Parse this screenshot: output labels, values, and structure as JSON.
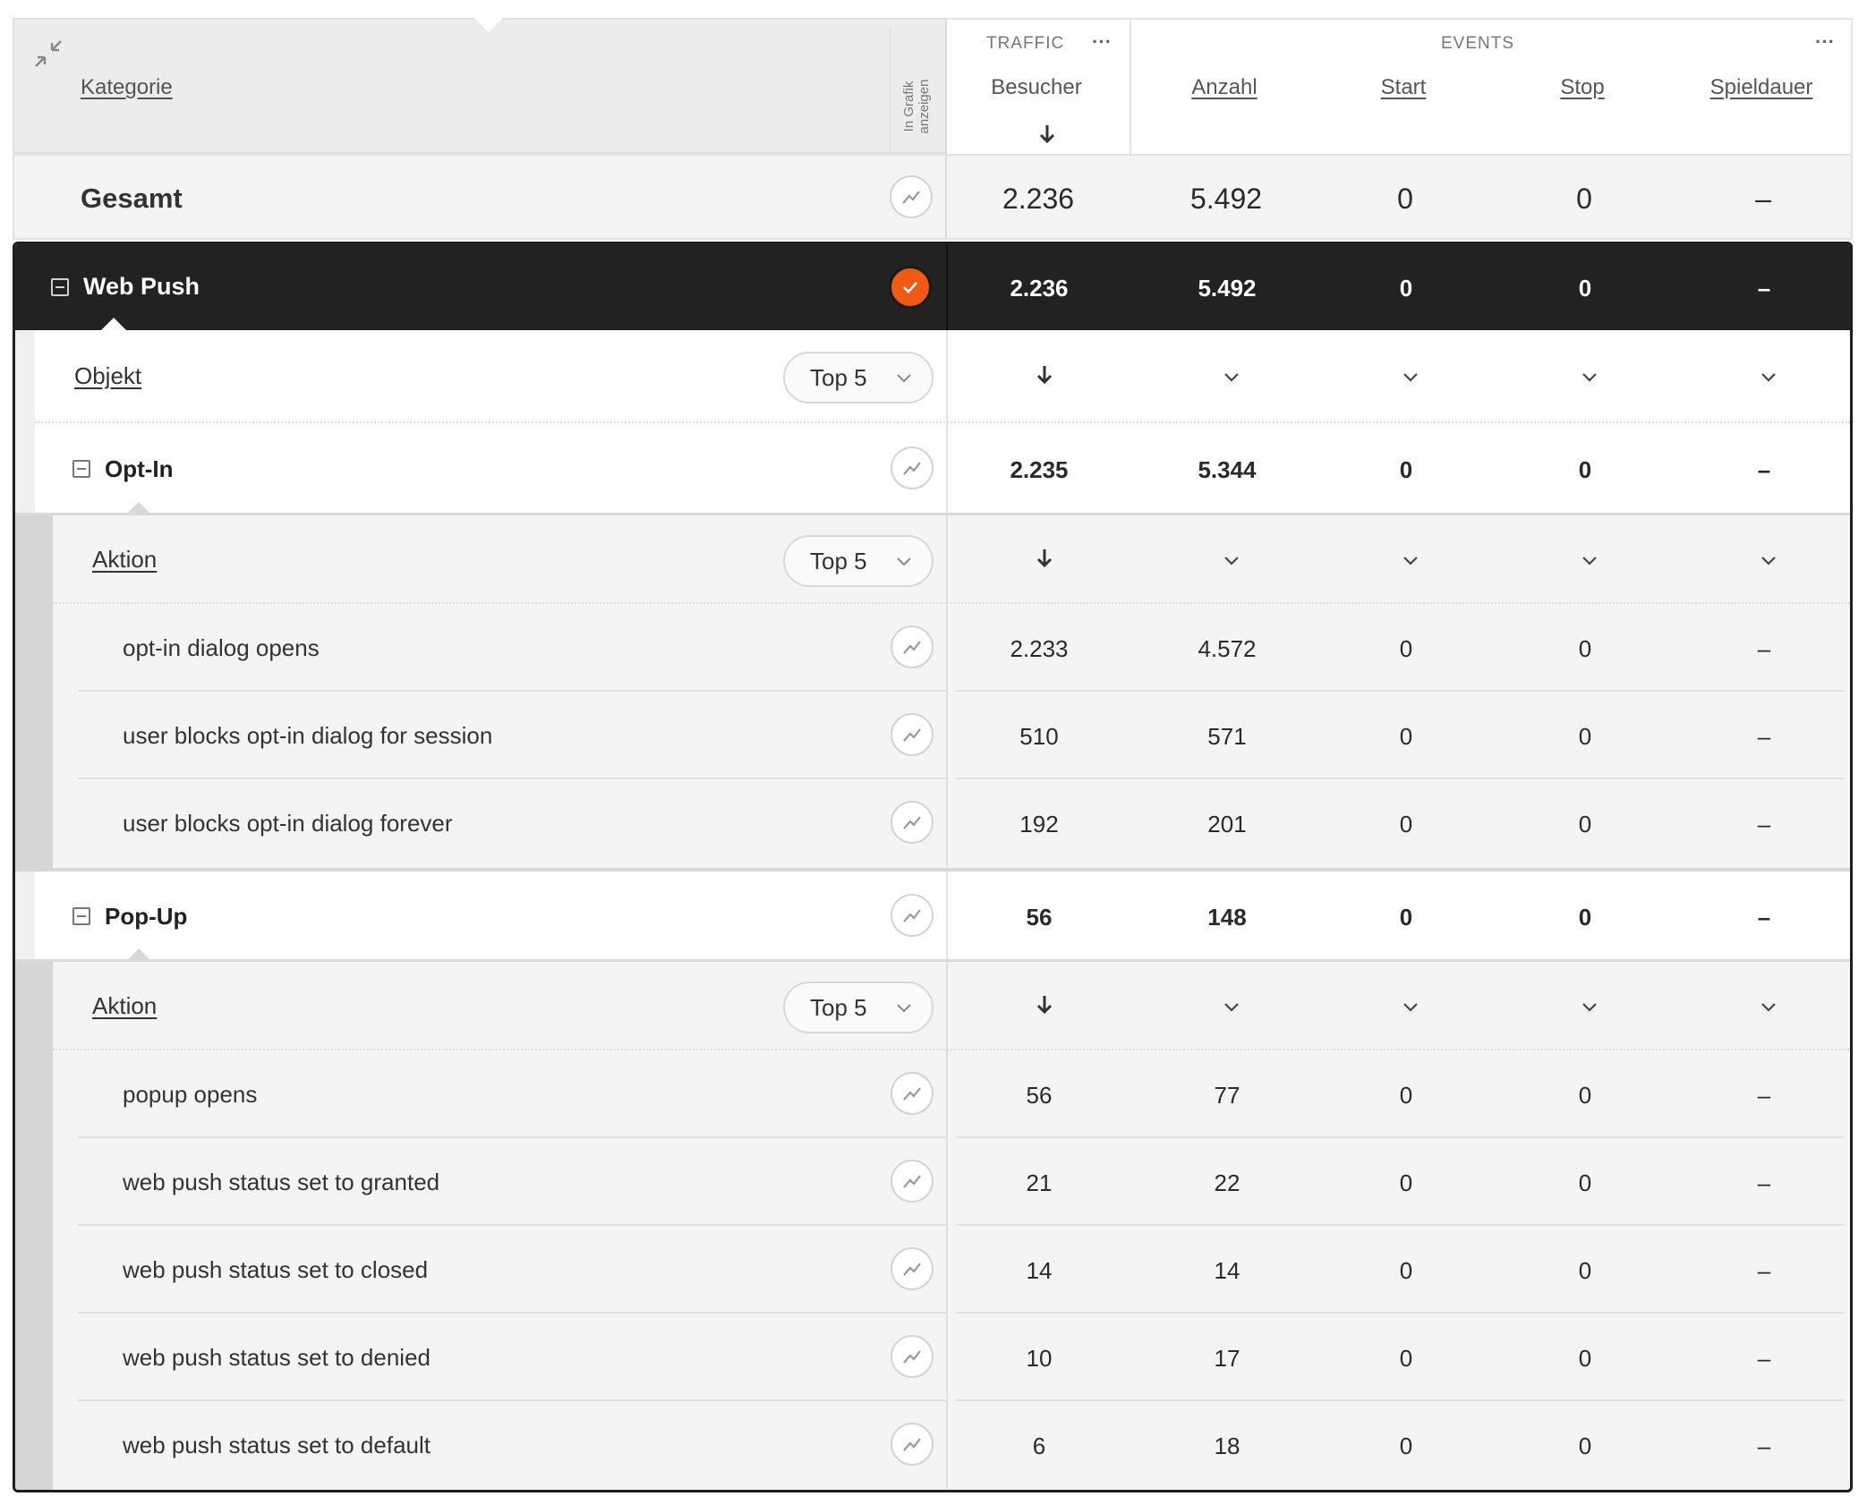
{
  "header": {
    "kategorie": "Kategorie",
    "chart_toggle_label": "In Grafik anzeigen",
    "groups": {
      "traffic": "TRAFFIC",
      "events": "EVENTS"
    },
    "columns": [
      "Besucher",
      "Anzahl",
      "Start",
      "Stop",
      "Spieldauer"
    ]
  },
  "total": {
    "label": "Gesamt",
    "values": [
      "2.236",
      "5.492",
      "0",
      "0",
      "–"
    ]
  },
  "web_push": {
    "label": "Web Push",
    "values": [
      "2.236",
      "5.492",
      "0",
      "0",
      "–"
    ]
  },
  "objekt": {
    "label": "Objekt",
    "top": "Top 5"
  },
  "opt_in": {
    "label": "Opt-In",
    "values": [
      "2.235",
      "5.344",
      "0",
      "0",
      "–"
    ],
    "aktion": {
      "label": "Aktion",
      "top": "Top 5"
    },
    "rows": [
      {
        "label": "opt-in dialog opens",
        "values": [
          "2.233",
          "4.572",
          "0",
          "0",
          "–"
        ]
      },
      {
        "label": "user blocks opt-in dialog for session",
        "values": [
          "510",
          "571",
          "0",
          "0",
          "–"
        ]
      },
      {
        "label": "user blocks opt-in dialog forever",
        "values": [
          "192",
          "201",
          "0",
          "0",
          "–"
        ]
      }
    ]
  },
  "pop_up": {
    "label": "Pop-Up",
    "values": [
      "56",
      "148",
      "0",
      "0",
      "–"
    ],
    "aktion": {
      "label": "Aktion",
      "top": "Top 5"
    },
    "rows": [
      {
        "label": "popup opens",
        "values": [
          "56",
          "77",
          "0",
          "0",
          "–"
        ]
      },
      {
        "label": "web push status set to granted",
        "values": [
          "21",
          "22",
          "0",
          "0",
          "–"
        ]
      },
      {
        "label": "web push status set to closed",
        "values": [
          "14",
          "14",
          "0",
          "0",
          "–"
        ]
      },
      {
        "label": "web push status set to denied",
        "values": [
          "10",
          "17",
          "0",
          "0",
          "–"
        ]
      },
      {
        "label": "web push status set to default",
        "values": [
          "6",
          "18",
          "0",
          "0",
          "–"
        ]
      }
    ]
  },
  "colors": {
    "accent": "#f05a16",
    "dark_row": "#222222",
    "panel": "#f4f4f4"
  }
}
